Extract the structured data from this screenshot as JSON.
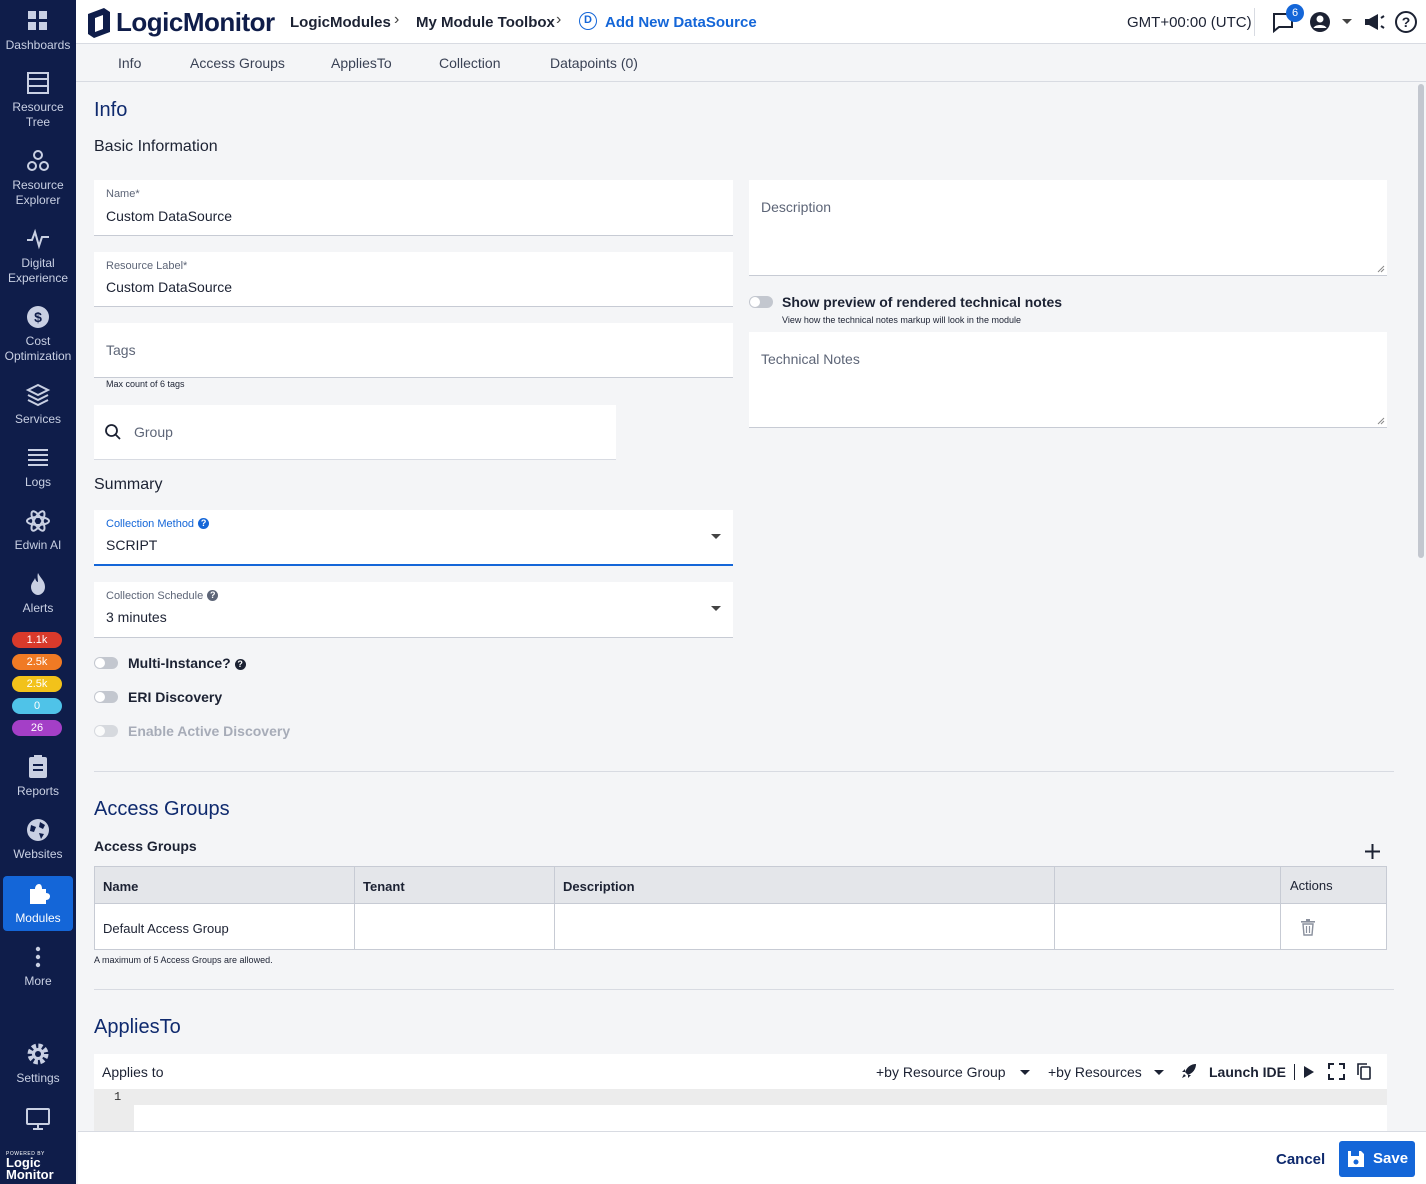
{
  "sidebar": {
    "items": [
      {
        "label": "Dashboards",
        "icon": "dashboards-icon"
      },
      {
        "label": "Resource Tree",
        "icon": "resource-tree-icon"
      },
      {
        "label": "Resource Explorer",
        "icon": "resource-explorer-icon"
      },
      {
        "label": "Digital Experience",
        "icon": "digital-experience-icon"
      },
      {
        "label": "Cost Optimization",
        "icon": "cost-optimization-icon"
      },
      {
        "label": "Services",
        "icon": "services-icon"
      },
      {
        "label": "Logs",
        "icon": "logs-icon"
      },
      {
        "label": "Edwin AI",
        "icon": "edwin-ai-icon"
      },
      {
        "label": "Alerts",
        "icon": "alerts-icon"
      },
      {
        "label": "Reports",
        "icon": "reports-icon"
      },
      {
        "label": "Websites",
        "icon": "websites-icon"
      },
      {
        "label": "Modules",
        "icon": "modules-icon"
      },
      {
        "label": "More",
        "icon": "more-icon"
      },
      {
        "label": "Settings",
        "icon": "settings-icon"
      }
    ],
    "alert_counts": [
      {
        "value": "1.1k",
        "color": "#d93a2b"
      },
      {
        "value": "2.5k",
        "color": "#f07a24"
      },
      {
        "value": "2.5k",
        "color": "#f2c21a"
      },
      {
        "value": "0",
        "color": "#4fc3e8"
      },
      {
        "value": "26",
        "color": "#a43fc7"
      }
    ],
    "powered_by": "POWERED BY",
    "brand_small": "Logic Monitor"
  },
  "header": {
    "logo": "LogicMonitor",
    "breadcrumbs": [
      "LogicModules",
      "My Module Toolbox",
      "Add New DataSource"
    ],
    "breadcrumb_badge": "D",
    "timezone": "GMT+00:00 (UTC)",
    "notifications": "6"
  },
  "tabs": [
    "Info",
    "Access Groups",
    "AppliesTo",
    "Collection",
    "Datapoints (0)"
  ],
  "info": {
    "title": "Info",
    "basic_title": "Basic Information",
    "name_label": "Name*",
    "name_value": "Custom DataSource",
    "resource_label_label": "Resource Label*",
    "resource_label_value": "Custom DataSource",
    "tags_placeholder": "Tags",
    "tags_hint": "Max count of 6 tags",
    "group_placeholder": "Group",
    "description_placeholder": "Description",
    "preview_toggle_label": "Show preview of rendered technical notes",
    "preview_toggle_hint": "View how the technical notes markup will look in the module",
    "technical_notes_placeholder": "Technical Notes"
  },
  "summary": {
    "title": "Summary",
    "collection_method_label": "Collection Method",
    "collection_method_value": "SCRIPT",
    "collection_schedule_label": "Collection Schedule",
    "collection_schedule_value": "3 minutes",
    "multi_instance_label": "Multi-Instance?",
    "eri_discovery_label": "ERI Discovery",
    "active_discovery_label": "Enable Active Discovery"
  },
  "access_groups": {
    "title": "Access Groups",
    "subtitle": "Access Groups",
    "columns": [
      "Name",
      "Tenant",
      "Description",
      "",
      "Actions"
    ],
    "rows": [
      {
        "name": "Default Access Group",
        "tenant": "",
        "description": ""
      }
    ],
    "hint": "A maximum of 5 Access Groups are allowed."
  },
  "applies_to": {
    "title": "AppliesTo",
    "label": "Applies to",
    "by_group": "+by Resource Group",
    "by_resources": "+by Resources",
    "launch_ide": "Launch IDE",
    "line_number": "1"
  },
  "footer": {
    "cancel": "Cancel",
    "save": "Save"
  },
  "colors": {
    "sidebar_bg": "#0f1d4a",
    "accent": "#1466d8"
  }
}
